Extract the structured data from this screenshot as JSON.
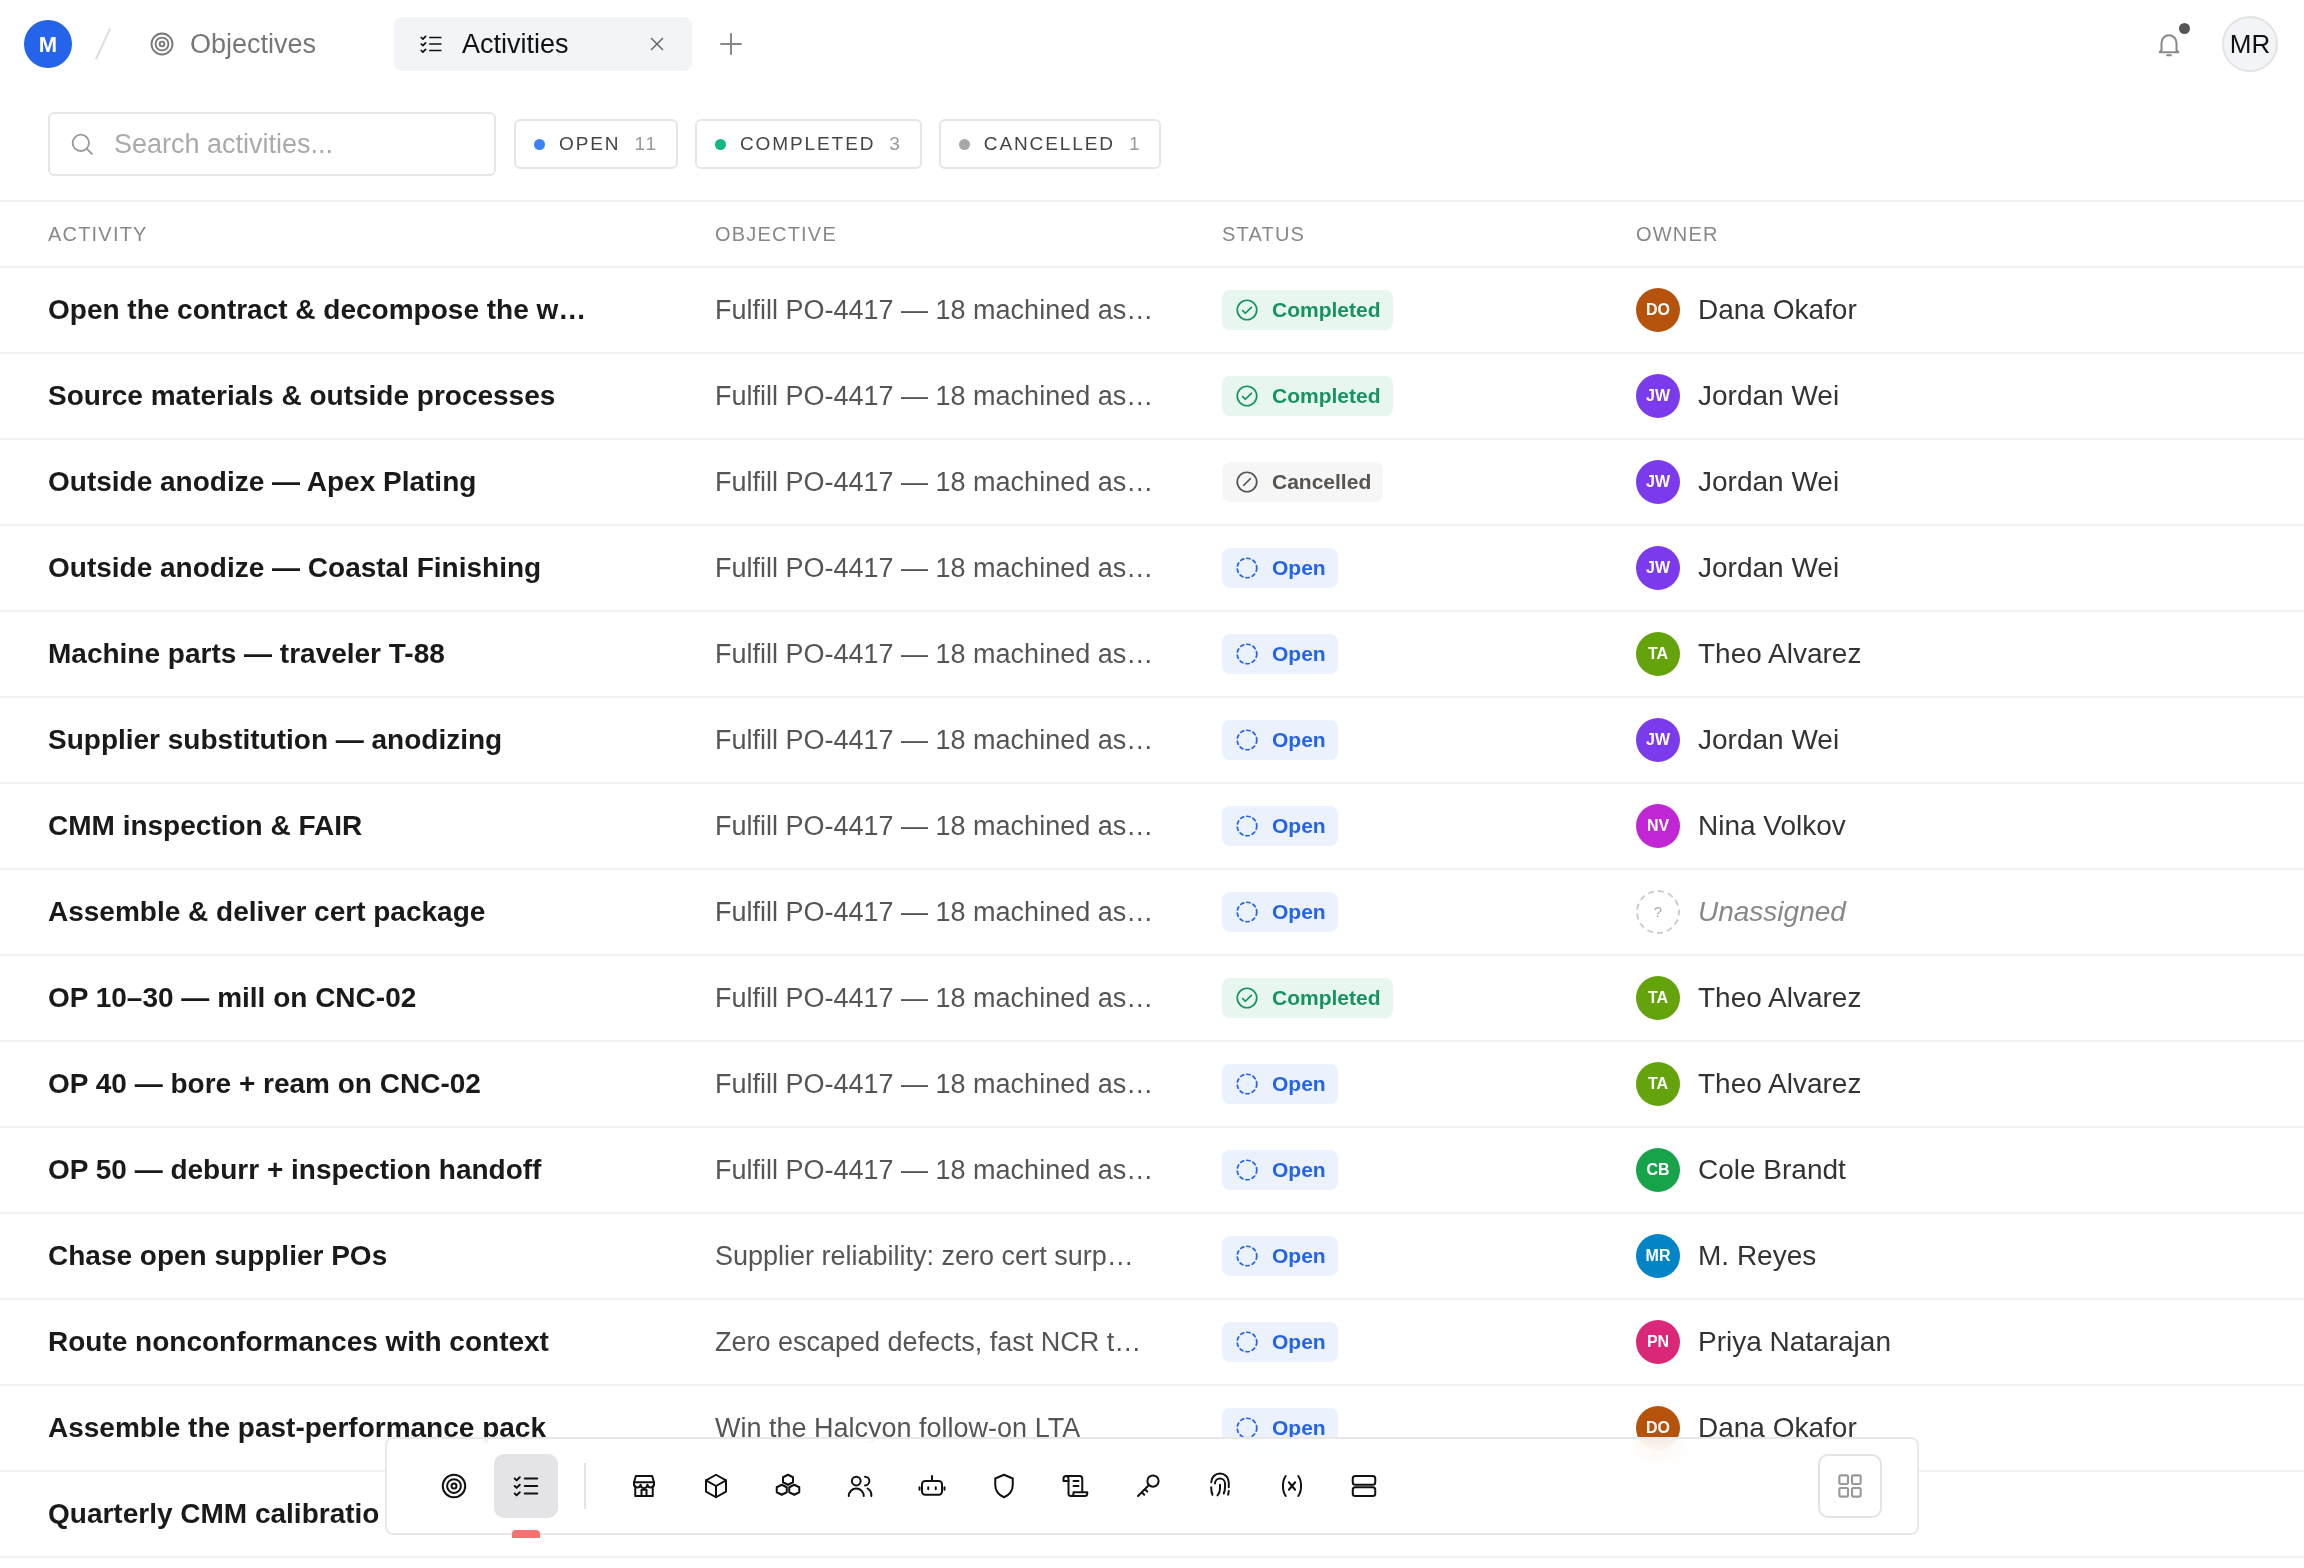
{
  "header": {
    "workspace_initial": "M",
    "breadcrumb": {
      "label": "Objectives",
      "selected": false
    },
    "tabs": [
      {
        "label": "Activities",
        "selected": true
      }
    ],
    "user_initials": "MR",
    "notifications_unread": true
  },
  "search": {
    "placeholder": "Search activities..."
  },
  "filters": [
    {
      "label": "OPEN",
      "count": "11",
      "color": "#3b82f6"
    },
    {
      "label": "COMPLETED",
      "count": "3",
      "color": "#10b981"
    },
    {
      "label": "CANCELLED",
      "count": "1",
      "color": "#a8a8a8"
    }
  ],
  "table": {
    "columns": [
      "ACTIVITY",
      "OBJECTIVE",
      "STATUS",
      "OWNER"
    ],
    "rows": [
      {
        "activity": "Open the contract & decompose the w…",
        "objective": "Fulfill PO-4417 — 18 machined as…",
        "status": {
          "kind": "completed",
          "label": "Completed"
        },
        "owner": {
          "initials": "DO",
          "name": "Dana Okafor",
          "color": "#b5530d"
        }
      },
      {
        "activity": "Source materials & outside processes",
        "objective": "Fulfill PO-4417 — 18 machined as…",
        "status": {
          "kind": "completed",
          "label": "Completed"
        },
        "owner": {
          "initials": "JW",
          "name": "Jordan Wei",
          "color": "#7c3aed"
        }
      },
      {
        "activity": "Outside anodize — Apex Plating",
        "objective": "Fulfill PO-4417 — 18 machined as…",
        "status": {
          "kind": "cancelled",
          "label": "Cancelled"
        },
        "owner": {
          "initials": "JW",
          "name": "Jordan Wei",
          "color": "#7c3aed"
        }
      },
      {
        "activity": "Outside anodize — Coastal Finishing",
        "objective": "Fulfill PO-4417 — 18 machined as…",
        "status": {
          "kind": "open",
          "label": "Open"
        },
        "owner": {
          "initials": "JW",
          "name": "Jordan Wei",
          "color": "#7c3aed"
        }
      },
      {
        "activity": "Machine parts — traveler T-88",
        "objective": "Fulfill PO-4417 — 18 machined as…",
        "status": {
          "kind": "open",
          "label": "Open"
        },
        "owner": {
          "initials": "TA",
          "name": "Theo Alvarez",
          "color": "#65a30d"
        }
      },
      {
        "activity": "Supplier substitution — anodizing",
        "objective": "Fulfill PO-4417 — 18 machined as…",
        "status": {
          "kind": "open",
          "label": "Open"
        },
        "owner": {
          "initials": "JW",
          "name": "Jordan Wei",
          "color": "#7c3aed"
        }
      },
      {
        "activity": "CMM inspection & FAIR",
        "objective": "Fulfill PO-4417 — 18 machined as…",
        "status": {
          "kind": "open",
          "label": "Open"
        },
        "owner": {
          "initials": "NV",
          "name": "Nina Volkov",
          "color": "#c026d3"
        }
      },
      {
        "activity": "Assemble & deliver cert package",
        "objective": "Fulfill PO-4417 — 18 machined as…",
        "status": {
          "kind": "open",
          "label": "Open"
        },
        "owner": {
          "kind": "unassigned",
          "initials": "?",
          "name": "Unassigned"
        }
      },
      {
        "activity": "OP 10–30 — mill on CNC-02",
        "objective": "Fulfill PO-4417 — 18 machined as…",
        "status": {
          "kind": "completed",
          "label": "Completed"
        },
        "owner": {
          "initials": "TA",
          "name": "Theo Alvarez",
          "color": "#65a30d"
        }
      },
      {
        "activity": "OP 40 — bore + ream on CNC-02",
        "objective": "Fulfill PO-4417 — 18 machined as…",
        "status": {
          "kind": "open",
          "label": "Open"
        },
        "owner": {
          "initials": "TA",
          "name": "Theo Alvarez",
          "color": "#65a30d"
        }
      },
      {
        "activity": "OP 50 — deburr + inspection handoff",
        "objective": "Fulfill PO-4417 — 18 machined as…",
        "status": {
          "kind": "open",
          "label": "Open"
        },
        "owner": {
          "initials": "CB",
          "name": "Cole Brandt",
          "color": "#16a34a"
        }
      },
      {
        "activity": "Chase open supplier POs",
        "objective": "Supplier reliability: zero cert surp…",
        "status": {
          "kind": "open",
          "label": "Open"
        },
        "owner": {
          "initials": "MR",
          "name": "M. Reyes",
          "color": "#0284c7"
        }
      },
      {
        "activity": "Route nonconformances with context",
        "objective": "Zero escaped defects, fast NCR t…",
        "status": {
          "kind": "open",
          "label": "Open"
        },
        "owner": {
          "initials": "PN",
          "name": "Priya Natarajan",
          "color": "#db2777"
        }
      },
      {
        "activity": "Assemble the past-performance pack",
        "objective": "Win the Halcyon follow-on LTA",
        "status": {
          "kind": "open",
          "label": "Open"
        },
        "owner": {
          "initials": "DO",
          "name": "Dana Okafor",
          "color": "#b5530d"
        }
      },
      {
        "activity": "Quarterly CMM calibratio"
      }
    ]
  },
  "dock": {
    "items": [
      {
        "selected": false
      },
      {
        "selected": true
      },
      {
        "selected": false
      },
      {
        "selected": false
      },
      {
        "selected": false
      },
      {
        "selected": false
      },
      {
        "selected": false
      },
      {
        "selected": false
      },
      {
        "selected": false
      },
      {
        "selected": false
      },
      {
        "selected": false
      },
      {
        "selected": false
      },
      {
        "selected": false
      }
    ]
  }
}
